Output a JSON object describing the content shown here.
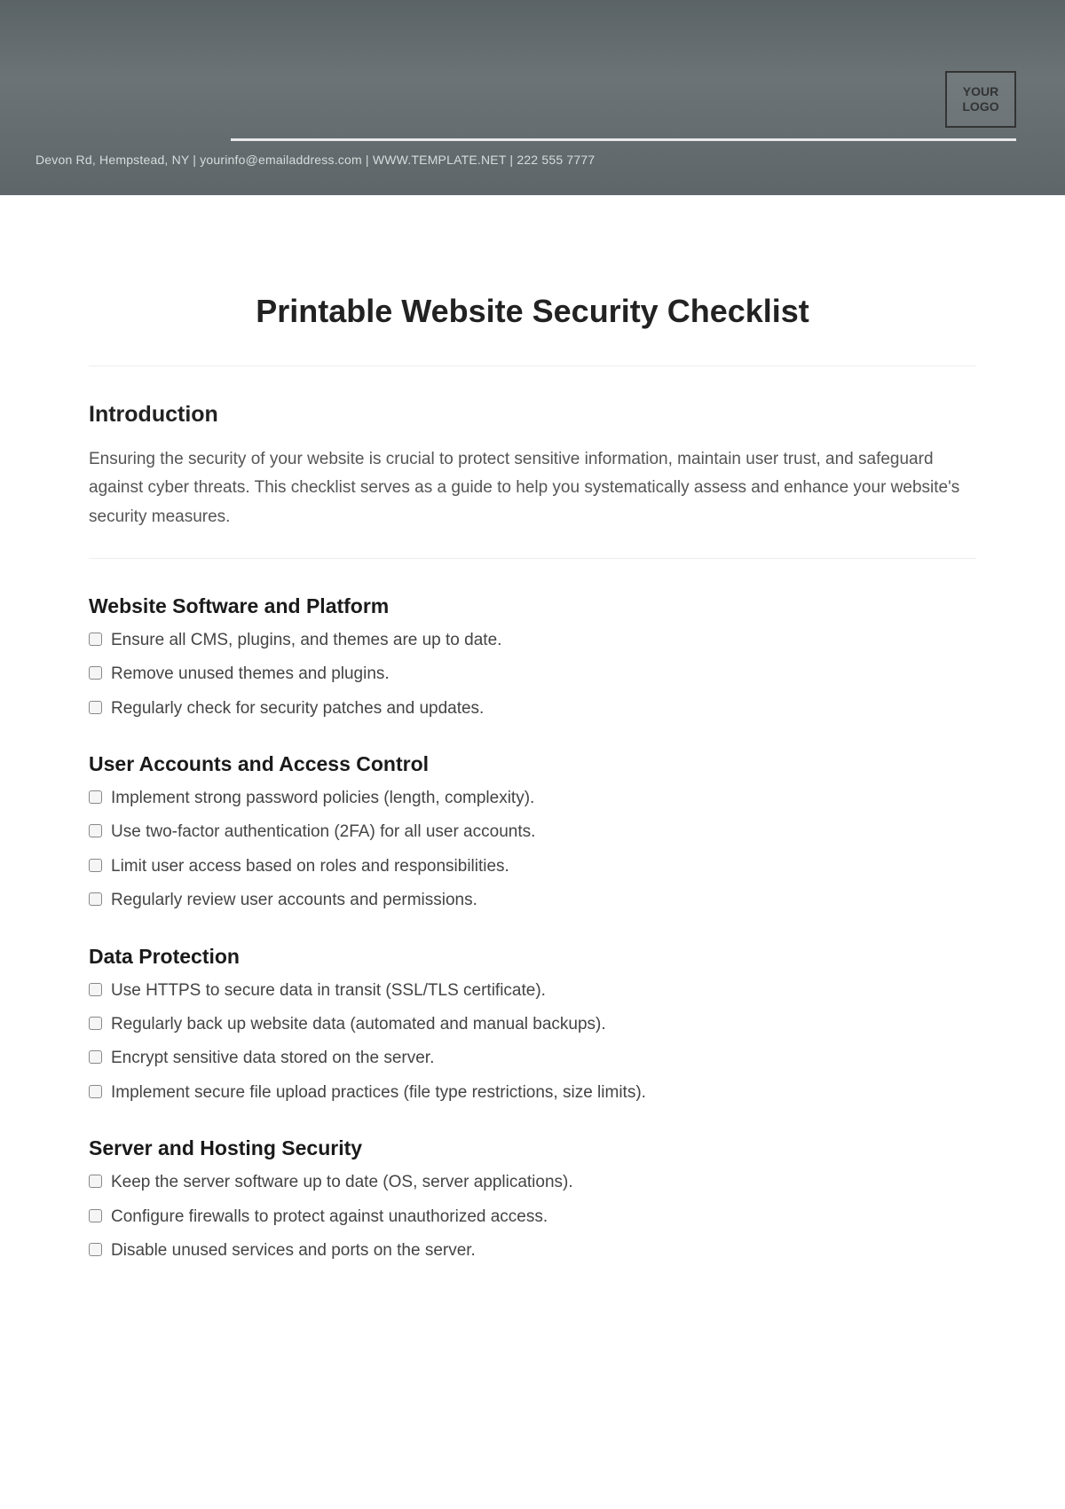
{
  "header": {
    "logo_text": "YOUR LOGO",
    "contact_line": "Devon Rd, Hempstead, NY | yourinfo@emailaddress.com | WWW.TEMPLATE.NET | 222 555 7777"
  },
  "document": {
    "title": "Printable Website Security Checklist"
  },
  "intro": {
    "heading": "Introduction",
    "body": "Ensuring the security of your website is crucial to protect sensitive information, maintain user trust, and safeguard against cyber threats. This checklist serves as a guide to help you systematically assess and enhance your website's security measures."
  },
  "sections": [
    {
      "heading": "Website Software and Platform",
      "items": [
        "Ensure all CMS, plugins, and themes are up to date.",
        "Remove unused themes and plugins.",
        "Regularly check for security patches and updates."
      ]
    },
    {
      "heading": "User Accounts and Access Control",
      "items": [
        "Implement strong password policies (length, complexity).",
        "Use two-factor authentication (2FA) for all user accounts.",
        "Limit user access based on roles and responsibilities.",
        "Regularly review user accounts and permissions."
      ]
    },
    {
      "heading": "Data Protection",
      "items": [
        "Use HTTPS to secure data in transit (SSL/TLS certificate).",
        "Regularly back up website data (automated and manual backups).",
        "Encrypt sensitive data stored on the server.",
        "Implement secure file upload practices (file type restrictions, size limits)."
      ]
    },
    {
      "heading": "Server and Hosting Security",
      "items": [
        "Keep the server software up to date (OS, server applications).",
        "Configure firewalls to protect against unauthorized access.",
        "Disable unused services and ports on the server."
      ]
    }
  ]
}
